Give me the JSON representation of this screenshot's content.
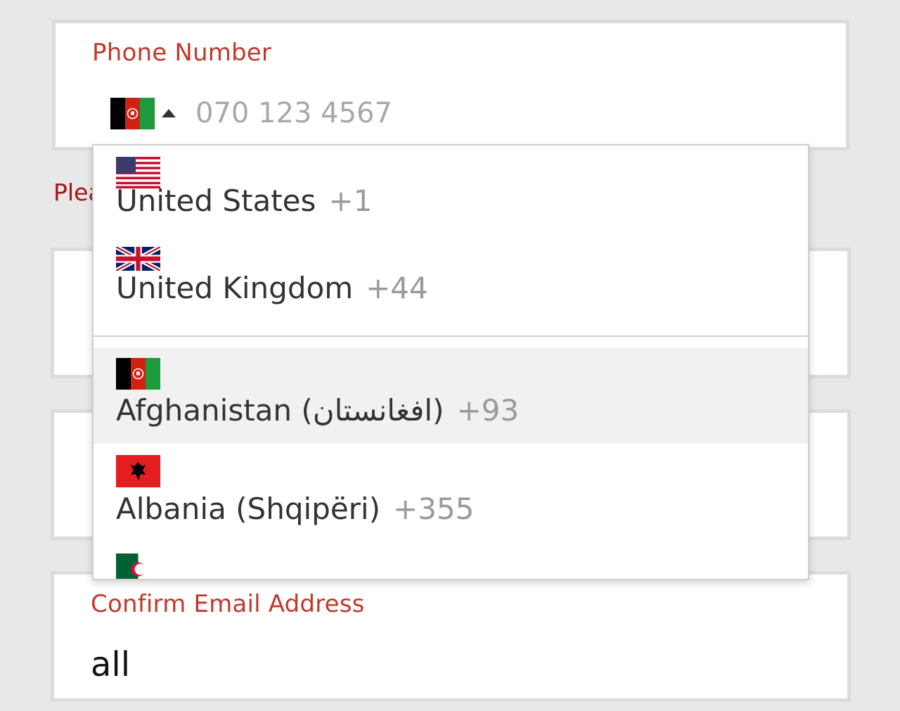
{
  "phone_field": {
    "label": "Phone Number",
    "selected_flag": "af-flag-icon",
    "placeholder": "070 123 4567",
    "helper_text": "Plea"
  },
  "dropdown": {
    "preferred": [
      {
        "name": "United States",
        "dial": "+1",
        "flag": "us-flag-icon"
      },
      {
        "name": "United Kingdom",
        "dial": "+44",
        "flag": "gb-flag-icon"
      }
    ],
    "countries": [
      {
        "name": "Afghanistan (‫افغانستان‬‎)",
        "dial": "+93",
        "flag": "af-flag-icon",
        "highlighted": true
      },
      {
        "name": "Albania (Shqipëri)",
        "dial": "+355",
        "flag": "al-flag-icon"
      },
      {
        "name": "",
        "dial": "",
        "flag": "dz-flag-icon"
      }
    ]
  },
  "email_confirm": {
    "label": "Confirm Email Address",
    "value": "all"
  },
  "colors": {
    "label_red": "#c0392b",
    "helper_red": "#a31515",
    "highlight_bg": "#f1f1f1"
  }
}
